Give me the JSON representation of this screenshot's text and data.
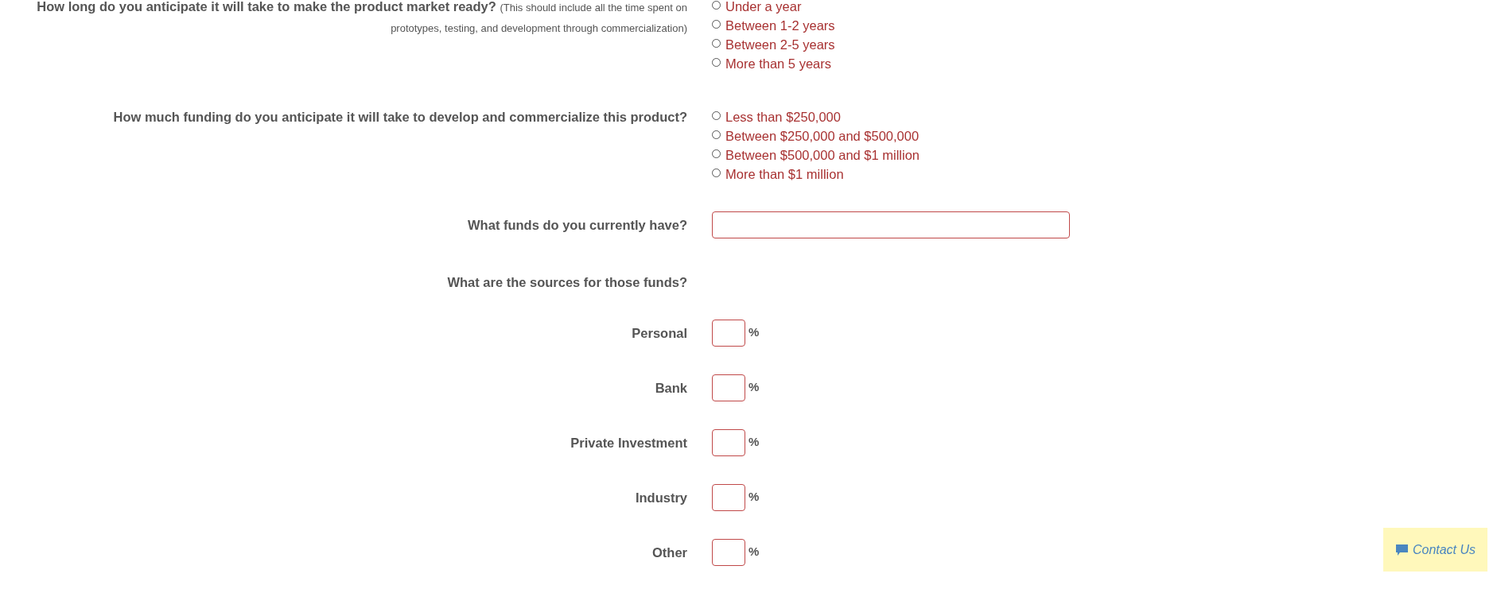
{
  "questions": [
    {
      "kind": "radio",
      "label": "How long do you anticipate it will take to make the product market ready?",
      "note": "(This should include all the time spent on prototypes, testing, and development through commercialization)",
      "options": [
        {
          "label": "Under a year",
          "selected": false
        },
        {
          "label": "Between 1-2 years",
          "selected": false
        },
        {
          "label": "Between 2-5 years",
          "selected": false
        },
        {
          "label": "More than 5 years",
          "selected": false
        }
      ]
    },
    {
      "kind": "radio",
      "label": "How much funding do you anticipate it will take to develop and commercialize this product?",
      "options": [
        {
          "label": "Less than $250,000",
          "selected": false
        },
        {
          "label": "Between $250,000 and $500,000",
          "selected": false
        },
        {
          "label": "Between $500,000 and $1 million",
          "selected": false
        },
        {
          "label": "More than $1 million",
          "selected": false
        }
      ]
    },
    {
      "kind": "text",
      "label": "What funds do you currently have?"
    },
    {
      "kind": "heading",
      "label": "What are the sources for those funds?"
    },
    {
      "kind": "percent",
      "label": "Personal",
      "unit": "%"
    },
    {
      "kind": "percent",
      "label": "Bank",
      "unit": "%"
    },
    {
      "kind": "percent",
      "label": "Private Investment",
      "unit": "%"
    },
    {
      "kind": "percent",
      "label": "Industry",
      "unit": "%"
    },
    {
      "kind": "percent",
      "label": "Other",
      "unit": "%"
    }
  ],
  "contact_button": {
    "label": "Contact Us"
  }
}
